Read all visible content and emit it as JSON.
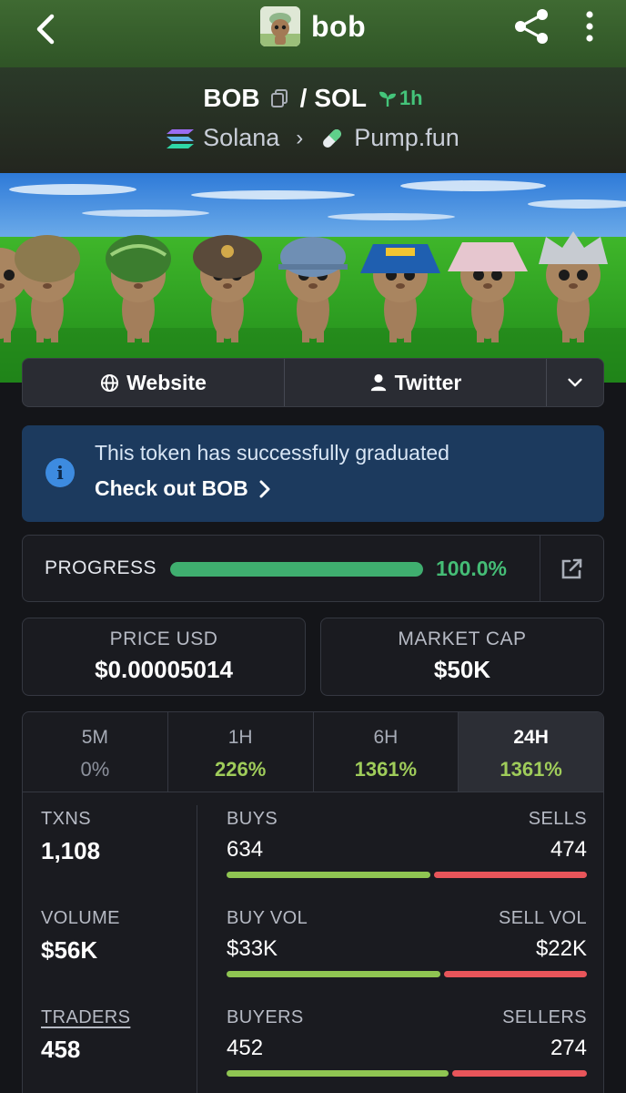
{
  "header": {
    "title": "bob"
  },
  "pair": {
    "base": "BOB",
    "separator": "/",
    "quote": "SOL",
    "age": "1h",
    "chain": "Solana",
    "dex": "Pump.fun"
  },
  "links": {
    "website": "Website",
    "twitter": "Twitter"
  },
  "notice": {
    "message": "This token has successfully graduated",
    "link": "Check out BOB"
  },
  "progress": {
    "label": "PROGRESS",
    "value": 100.0,
    "display": "100.0%"
  },
  "price": {
    "label": "PRICE USD",
    "value": "$0.00005014"
  },
  "market_cap": {
    "label": "MARKET CAP",
    "value": "$50K"
  },
  "timeframes": [
    {
      "label": "5M",
      "change": "0%"
    },
    {
      "label": "1H",
      "change": "226%"
    },
    {
      "label": "6H",
      "change": "1361%"
    },
    {
      "label": "24H",
      "change": "1361%",
      "active": true
    }
  ],
  "stats": {
    "txns": {
      "label": "TXNS",
      "value": "1,108"
    },
    "volume": {
      "label": "VOLUME",
      "value": "$56K"
    },
    "traders": {
      "label": "TRADERS",
      "value": "458"
    },
    "buys": {
      "label": "BUYS",
      "value": "634",
      "n": 634
    },
    "sells": {
      "label": "SELLS",
      "value": "474",
      "n": 474
    },
    "buy_vol": {
      "label": "BUY VOL",
      "value": "$33K",
      "n": 33
    },
    "sell_vol": {
      "label": "SELL VOL",
      "value": "$22K",
      "n": 22
    },
    "buyers": {
      "label": "BUYERS",
      "value": "452",
      "n": 452
    },
    "sellers": {
      "label": "SELLERS",
      "value": "274",
      "n": 274
    }
  },
  "colors": {
    "positive": "#9fcc5a",
    "progress": "#3fae6f",
    "buy_bar": "#8fc552",
    "sell_bar": "#e8555a",
    "notice_bg": "#1c3a5e"
  }
}
